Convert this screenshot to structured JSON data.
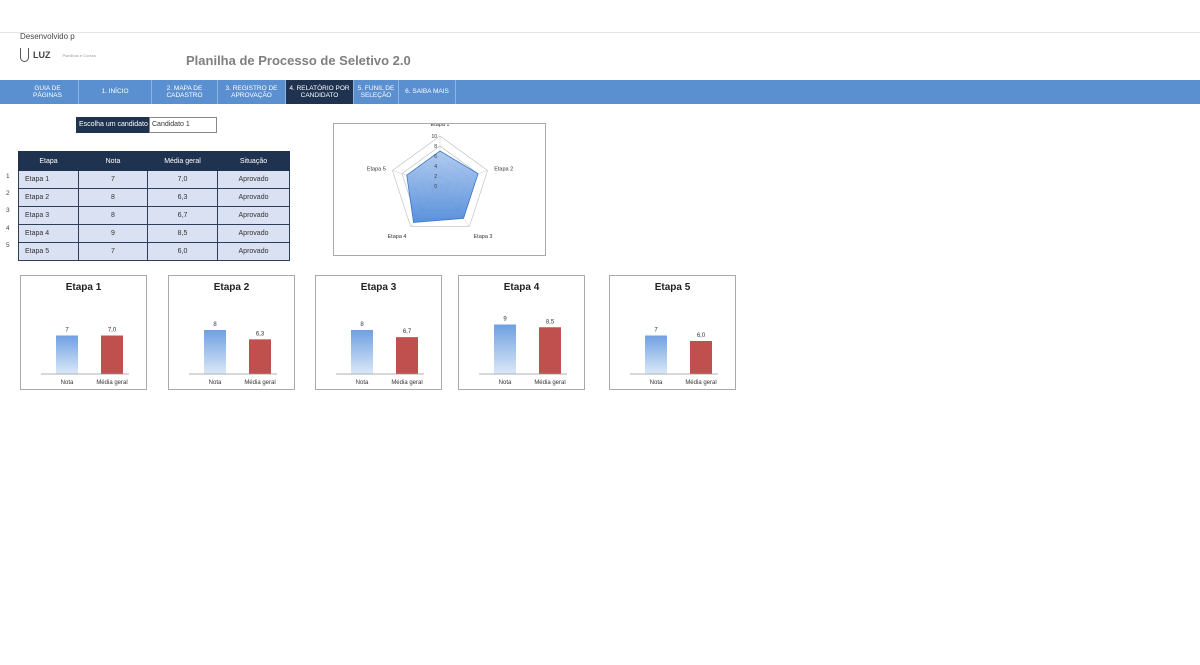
{
  "header": {
    "developed_by": "Desenvolvido p",
    "logo_name": "LUZ",
    "logo_tagline": "Planilhas e Cursos",
    "title": "Planilha de Processo de Seletivo 2.0"
  },
  "nav": {
    "items": [
      {
        "label": "GUIA DE PÁGINAS",
        "active": false
      },
      {
        "label": "1. INÍCIO",
        "active": false
      },
      {
        "label": "2. MAPA DE CADASTRO",
        "active": false
      },
      {
        "label": "3. REGISTRO DE APROVAÇÃO",
        "active": false
      },
      {
        "label": "4. RELATÓRIO POR CANDIDATO",
        "active": true
      },
      {
        "label": "5. FUNIL DE SELEÇÃO",
        "active": false
      },
      {
        "label": "6. SAIBA MAIS",
        "active": false
      }
    ]
  },
  "picker": {
    "label": "Escolha um candidato",
    "value": "Candidato 1"
  },
  "table": {
    "headers": [
      "Etapa",
      "Nota",
      "Média geral",
      "Situação"
    ],
    "row_numbers": [
      "1",
      "2",
      "3",
      "4",
      "5"
    ],
    "rows": [
      [
        "Etapa 1",
        "7",
        "7,0",
        "Aprovado"
      ],
      [
        "Etapa 2",
        "8",
        "6,3",
        "Aprovado"
      ],
      [
        "Etapa 3",
        "8",
        "6,7",
        "Aprovado"
      ],
      [
        "Etapa 4",
        "9",
        "8,5",
        "Aprovado"
      ],
      [
        "Etapa 5",
        "7",
        "6,0",
        "Aprovado"
      ]
    ]
  },
  "colors": {
    "nav_bg": "#5a8fd0",
    "nav_active": "#1f3350",
    "table_header": "#1f3350",
    "table_cell": "#d9e1f2",
    "bar_nota": "#6fa0e0",
    "bar_media": "#c0504d"
  },
  "chart_data": [
    {
      "type": "radar",
      "categories": [
        "Etapa 1",
        "Etapa 2",
        "Etapa 3",
        "Etapa 4",
        "Etapa 5"
      ],
      "values": [
        7,
        8,
        8,
        9,
        7
      ],
      "ticks": [
        "0",
        "2",
        "4",
        "6",
        "8",
        "10"
      ],
      "ylim": [
        0,
        10
      ]
    },
    {
      "type": "bar",
      "title": "Etapa 1",
      "categories": [
        "Nota",
        "Média geral"
      ],
      "values": [
        7,
        7.0
      ],
      "labels": [
        "7",
        "7,0"
      ],
      "ylim": [
        0,
        10
      ]
    },
    {
      "type": "bar",
      "title": "Etapa 2",
      "categories": [
        "Nota",
        "Média geral"
      ],
      "values": [
        8,
        6.3
      ],
      "labels": [
        "8",
        "6,3"
      ],
      "ylim": [
        0,
        10
      ]
    },
    {
      "type": "bar",
      "title": "Etapa 3",
      "categories": [
        "Nota",
        "Média geral"
      ],
      "values": [
        8,
        6.7
      ],
      "labels": [
        "8",
        "6,7"
      ],
      "ylim": [
        0,
        10
      ]
    },
    {
      "type": "bar",
      "title": "Etapa 4",
      "categories": [
        "Nota",
        "Média geral"
      ],
      "values": [
        9,
        8.5
      ],
      "labels": [
        "9",
        "8,5"
      ],
      "ylim": [
        0,
        10
      ]
    },
    {
      "type": "bar",
      "title": "Etapa 5",
      "categories": [
        "Nota",
        "Média geral"
      ],
      "values": [
        7,
        6.0
      ],
      "labels": [
        "7",
        "6,0"
      ],
      "ylim": [
        0,
        10
      ]
    }
  ]
}
